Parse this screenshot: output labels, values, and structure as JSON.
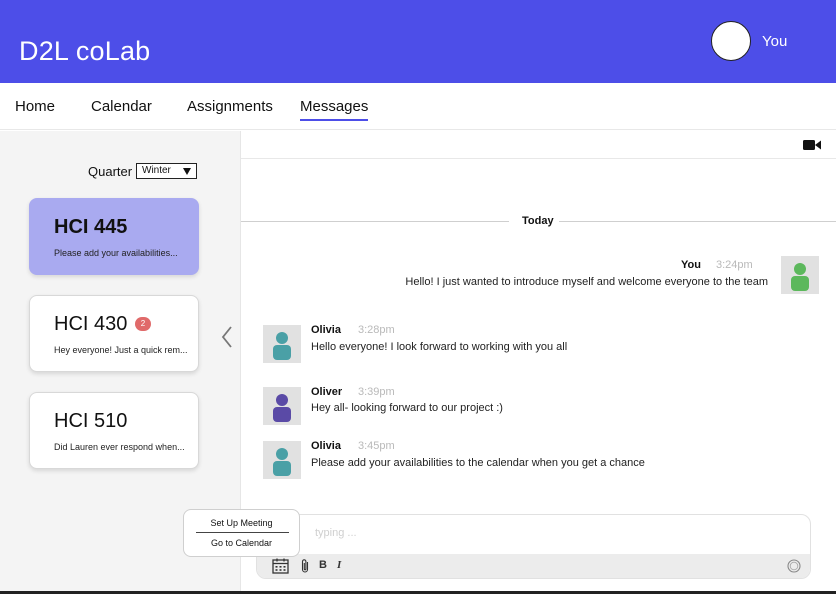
{
  "app": {
    "title": "D2L coLab",
    "user_label": "You",
    "accent": "#4d4ee8"
  },
  "nav": {
    "items": [
      {
        "label": "Home"
      },
      {
        "label": "Calendar"
      },
      {
        "label": "Assignments"
      },
      {
        "label": "Messages",
        "active": true
      }
    ]
  },
  "sidebar": {
    "quarter_label": "Quarter",
    "quarter_value": "Winter",
    "courses": [
      {
        "title": "HCI 445",
        "preview": "Please add your availabilities...",
        "selected": true
      },
      {
        "title": "HCI 430",
        "preview": "Hey everyone! Just a quick rem...",
        "badge": "2"
      },
      {
        "title": "HCI 510",
        "preview": "Did Lauren ever respond when..."
      }
    ]
  },
  "chat": {
    "divider_label": "Today",
    "messages": [
      {
        "name": "You",
        "time": "3:24pm",
        "text": "Hello! I just wanted to introduce myself and welcome everyone to the team",
        "avatar_color": "#5cb85c"
      },
      {
        "name": "Olivia",
        "time": "3:28pm",
        "text": "Hello everyone! I look forward to working with you all",
        "avatar_color": "#4aa0a6"
      },
      {
        "name": "Oliver",
        "time": "3:39pm",
        "text": "Hey all- looking forward to our project :)",
        "avatar_color": "#5a4aa6"
      },
      {
        "name": "Olivia",
        "time": "3:45pm",
        "text": "Please add your availabilities to the calendar when you get a chance",
        "avatar_color": "#4aa0a6"
      }
    ],
    "composer_placeholder": "typing ...",
    "toolbar": {
      "bold": "B",
      "italic": "I"
    }
  },
  "popup_menu": {
    "items": [
      {
        "label": "Set Up Meeting"
      },
      {
        "label": "Go to Calendar"
      }
    ]
  }
}
